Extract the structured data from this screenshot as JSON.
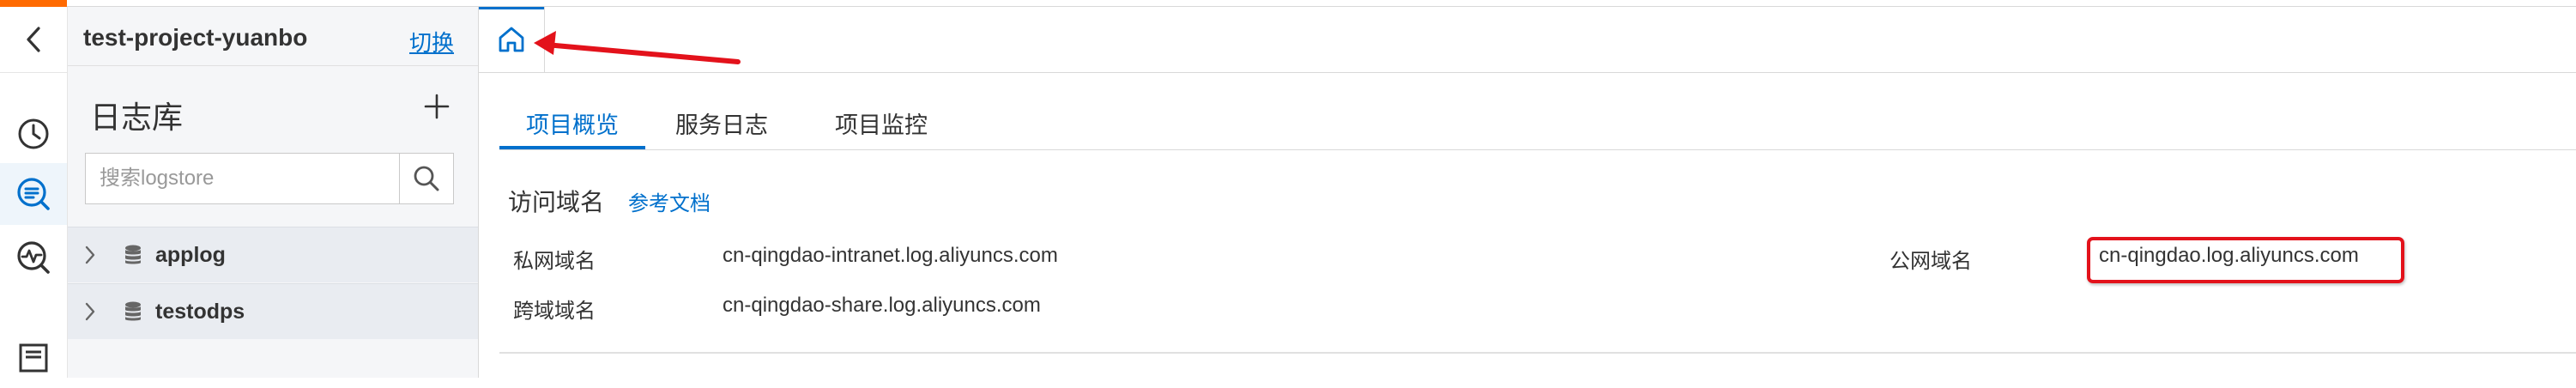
{
  "sidebar": {
    "project_name": "test-project-yuanbo",
    "switch_label": "切换",
    "panel_title": "日志库",
    "search": {
      "placeholder": "搜索logstore"
    },
    "logstores": [
      {
        "name": "applog"
      },
      {
        "name": "testodps"
      }
    ],
    "rail_icons": [
      "back-icon",
      "clock-icon",
      "log-search-icon",
      "monitor-search-icon",
      "dashboard-icon"
    ]
  },
  "main": {
    "home_tab_icon": "home-icon",
    "tabs": [
      {
        "label": "项目概览",
        "active": true
      },
      {
        "label": "服务日志",
        "active": false
      },
      {
        "label": "项目监控",
        "active": false
      }
    ],
    "section_title": "访问域名",
    "doc_link": "参考文档",
    "domains": {
      "private_label": "私网域名",
      "private_value": "cn-qingdao-intranet.log.aliyuncs.com",
      "cross_label": "跨域域名",
      "cross_value": "cn-qingdao-share.log.aliyuncs.com",
      "public_label": "公网域名",
      "public_value": "cn-qingdao.log.aliyuncs.com"
    }
  },
  "colors": {
    "accent": "#0070cc",
    "brand": "#ff6a00",
    "annotation": "#e3121b"
  }
}
